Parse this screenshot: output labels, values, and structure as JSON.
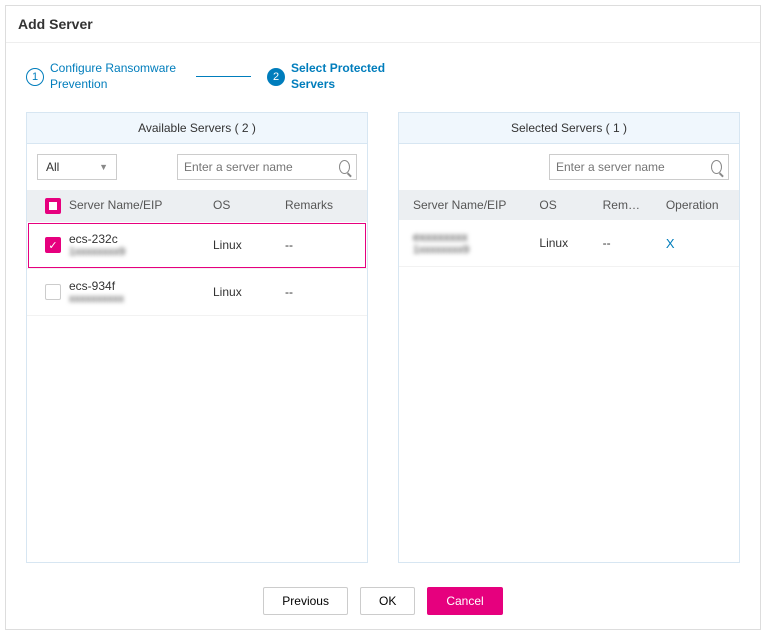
{
  "title": "Add Server",
  "steps": {
    "step1": {
      "num": "1",
      "label": "Configure Ransomware Prevention"
    },
    "step2": {
      "num": "2",
      "label": "Select Protected Servers"
    }
  },
  "available": {
    "header": "Available Servers ( 2 )",
    "filter": "All",
    "search_placeholder": "Enter a server name",
    "columns": {
      "name": "Server Name/EIP",
      "os": "OS",
      "remarks": "Remarks"
    },
    "rows": [
      {
        "name": "ecs-232c",
        "sub": "1xxxxxxxx9",
        "os": "Linux",
        "remarks": "--",
        "checked": true
      },
      {
        "name": "ecs-934f",
        "sub": "xxxxxxxxxx",
        "os": "Linux",
        "remarks": "--",
        "checked": false
      }
    ]
  },
  "selected": {
    "header": "Selected Servers ( 1 )",
    "search_placeholder": "Enter a server name",
    "columns": {
      "name": "Server Name/EIP",
      "os": "OS",
      "remarks": "Rem…",
      "operation": "Operation"
    },
    "rows": [
      {
        "name": "exxxxxxxx",
        "sub": "1xxxxxxxx9",
        "os": "Linux",
        "remarks": "--",
        "op": "X"
      }
    ]
  },
  "buttons": {
    "previous": "Previous",
    "ok": "OK",
    "cancel": "Cancel"
  }
}
